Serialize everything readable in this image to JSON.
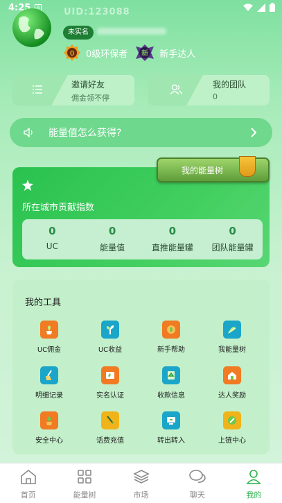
{
  "status_bar": {
    "time": "4:25",
    "sim_label": "A"
  },
  "profile": {
    "uid": "UID:123088",
    "realname_badge": "未实名",
    "level_badge_number": "0",
    "level_title": "0级环保者",
    "new_badge_char": "新",
    "new_title": "新手达人"
  },
  "invite_card": {
    "title": "邀请好友",
    "subtitle": "佣金领不停"
  },
  "team_card": {
    "title": "我的团队",
    "count": "0"
  },
  "energy_question": {
    "label": "能量值怎么获得?"
  },
  "energy_tree_button": {
    "label": "我的能量树"
  },
  "city_card": {
    "title": "所在城市贡献指数",
    "stats": [
      {
        "value": "0",
        "label": "UC"
      },
      {
        "value": "0",
        "label": "能量值"
      },
      {
        "value": "0",
        "label": "直推能量罐"
      },
      {
        "value": "0",
        "label": "团队能量罐"
      }
    ]
  },
  "tools": {
    "title": "我的工具",
    "items": [
      {
        "label": "UC佣金",
        "icon": "plant-pot-icon",
        "color": "#f07b22"
      },
      {
        "label": "UC收益",
        "icon": "seedling-icon",
        "color": "#1aa5c9"
      },
      {
        "label": "新手帮助",
        "icon": "leaf-badge-icon",
        "color": "#f07b22"
      },
      {
        "label": "我能量树",
        "icon": "tree-icon",
        "color": "#1aa5c9"
      },
      {
        "label": "明细记录",
        "icon": "broom-icon",
        "color": "#1aa5c9"
      },
      {
        "label": "实名认证",
        "icon": "id-plant-icon",
        "color": "#f07b22"
      },
      {
        "label": "收款信息",
        "icon": "recycle-icon",
        "color": "#1aa5c9"
      },
      {
        "label": "达人奖励",
        "icon": "house-icon",
        "color": "#f07b22"
      },
      {
        "label": "安全中心",
        "icon": "shield-plant-icon",
        "color": "#f07b22"
      },
      {
        "label": "话费充值",
        "icon": "phone-plant-icon",
        "color": "#f0b41a"
      },
      {
        "label": "转出转入",
        "icon": "transfer-icon",
        "color": "#1aa5c9"
      },
      {
        "label": "上链中心",
        "icon": "chain-coin-icon",
        "color": "#f0b41a"
      }
    ]
  },
  "nav": {
    "items": [
      {
        "label": "首页",
        "icon": "home-icon"
      },
      {
        "label": "能量树",
        "icon": "grid-icon"
      },
      {
        "label": "市场",
        "icon": "layers-icon"
      },
      {
        "label": "聊天",
        "icon": "chat-icon"
      },
      {
        "label": "我的",
        "icon": "person-icon",
        "active": true
      }
    ]
  }
}
